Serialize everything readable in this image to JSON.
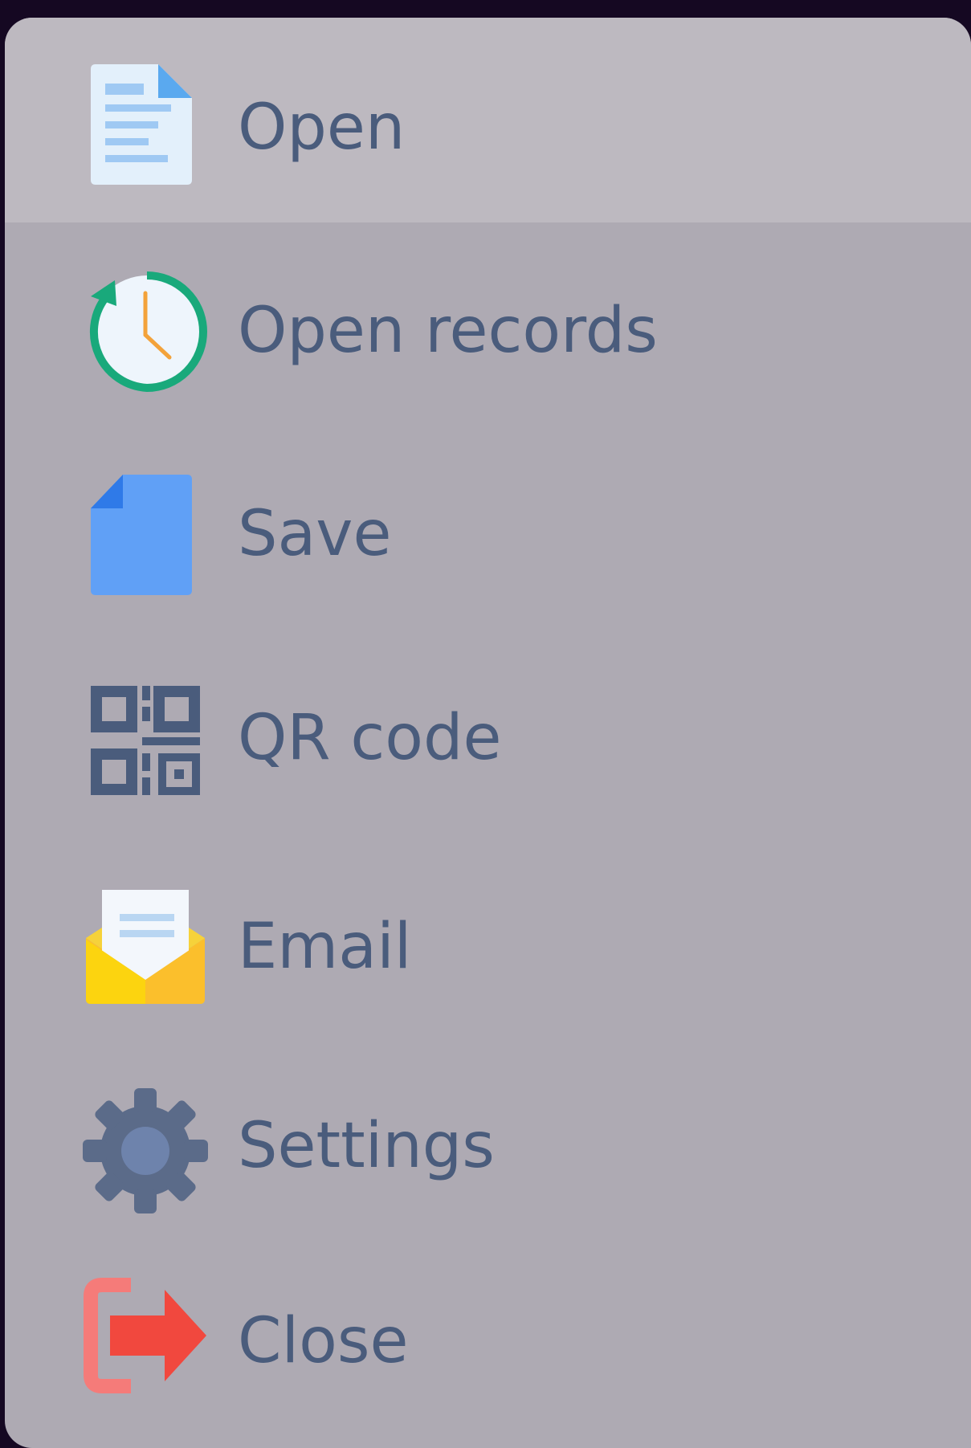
{
  "menu": {
    "items": [
      {
        "label": "Open",
        "icon": "document-icon",
        "active": true
      },
      {
        "label": "Open records",
        "icon": "history-clock-icon",
        "active": false
      },
      {
        "label": "Save",
        "icon": "save-file-icon",
        "active": false
      },
      {
        "label": "QR code",
        "icon": "qr-code-icon",
        "active": false
      },
      {
        "label": "Email",
        "icon": "email-icon",
        "active": false
      },
      {
        "label": "Settings",
        "icon": "gear-icon",
        "active": false
      },
      {
        "label": "Close",
        "icon": "exit-icon",
        "active": false
      }
    ]
  },
  "colors": {
    "background": "#150822",
    "menu_bg": "#aeaab3",
    "active_item_bg": "#bdb9c0",
    "label_text": "#4a5c7c"
  }
}
